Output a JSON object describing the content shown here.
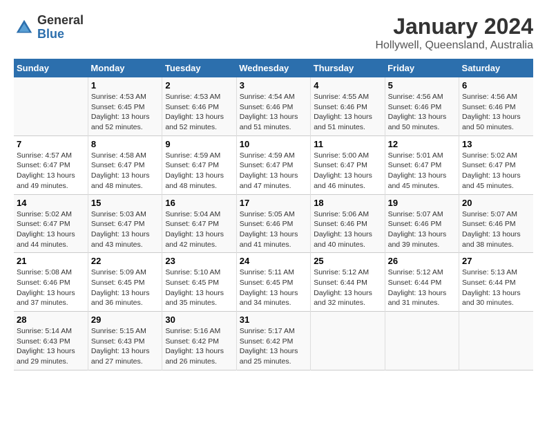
{
  "header": {
    "logo_line1": "General",
    "logo_line2": "Blue",
    "title": "January 2024",
    "subtitle": "Hollywell, Queensland, Australia"
  },
  "days_of_week": [
    "Sunday",
    "Monday",
    "Tuesday",
    "Wednesday",
    "Thursday",
    "Friday",
    "Saturday"
  ],
  "weeks": [
    [
      {
        "day": "",
        "info": ""
      },
      {
        "day": "1",
        "info": "Sunrise: 4:53 AM\nSunset: 6:45 PM\nDaylight: 13 hours\nand 52 minutes."
      },
      {
        "day": "2",
        "info": "Sunrise: 4:53 AM\nSunset: 6:46 PM\nDaylight: 13 hours\nand 52 minutes."
      },
      {
        "day": "3",
        "info": "Sunrise: 4:54 AM\nSunset: 6:46 PM\nDaylight: 13 hours\nand 51 minutes."
      },
      {
        "day": "4",
        "info": "Sunrise: 4:55 AM\nSunset: 6:46 PM\nDaylight: 13 hours\nand 51 minutes."
      },
      {
        "day": "5",
        "info": "Sunrise: 4:56 AM\nSunset: 6:46 PM\nDaylight: 13 hours\nand 50 minutes."
      },
      {
        "day": "6",
        "info": "Sunrise: 4:56 AM\nSunset: 6:46 PM\nDaylight: 13 hours\nand 50 minutes."
      }
    ],
    [
      {
        "day": "7",
        "info": "Sunrise: 4:57 AM\nSunset: 6:47 PM\nDaylight: 13 hours\nand 49 minutes."
      },
      {
        "day": "8",
        "info": "Sunrise: 4:58 AM\nSunset: 6:47 PM\nDaylight: 13 hours\nand 48 minutes."
      },
      {
        "day": "9",
        "info": "Sunrise: 4:59 AM\nSunset: 6:47 PM\nDaylight: 13 hours\nand 48 minutes."
      },
      {
        "day": "10",
        "info": "Sunrise: 4:59 AM\nSunset: 6:47 PM\nDaylight: 13 hours\nand 47 minutes."
      },
      {
        "day": "11",
        "info": "Sunrise: 5:00 AM\nSunset: 6:47 PM\nDaylight: 13 hours\nand 46 minutes."
      },
      {
        "day": "12",
        "info": "Sunrise: 5:01 AM\nSunset: 6:47 PM\nDaylight: 13 hours\nand 45 minutes."
      },
      {
        "day": "13",
        "info": "Sunrise: 5:02 AM\nSunset: 6:47 PM\nDaylight: 13 hours\nand 45 minutes."
      }
    ],
    [
      {
        "day": "14",
        "info": "Sunrise: 5:02 AM\nSunset: 6:47 PM\nDaylight: 13 hours\nand 44 minutes."
      },
      {
        "day": "15",
        "info": "Sunrise: 5:03 AM\nSunset: 6:47 PM\nDaylight: 13 hours\nand 43 minutes."
      },
      {
        "day": "16",
        "info": "Sunrise: 5:04 AM\nSunset: 6:47 PM\nDaylight: 13 hours\nand 42 minutes."
      },
      {
        "day": "17",
        "info": "Sunrise: 5:05 AM\nSunset: 6:46 PM\nDaylight: 13 hours\nand 41 minutes."
      },
      {
        "day": "18",
        "info": "Sunrise: 5:06 AM\nSunset: 6:46 PM\nDaylight: 13 hours\nand 40 minutes."
      },
      {
        "day": "19",
        "info": "Sunrise: 5:07 AM\nSunset: 6:46 PM\nDaylight: 13 hours\nand 39 minutes."
      },
      {
        "day": "20",
        "info": "Sunrise: 5:07 AM\nSunset: 6:46 PM\nDaylight: 13 hours\nand 38 minutes."
      }
    ],
    [
      {
        "day": "21",
        "info": "Sunrise: 5:08 AM\nSunset: 6:46 PM\nDaylight: 13 hours\nand 37 minutes."
      },
      {
        "day": "22",
        "info": "Sunrise: 5:09 AM\nSunset: 6:45 PM\nDaylight: 13 hours\nand 36 minutes."
      },
      {
        "day": "23",
        "info": "Sunrise: 5:10 AM\nSunset: 6:45 PM\nDaylight: 13 hours\nand 35 minutes."
      },
      {
        "day": "24",
        "info": "Sunrise: 5:11 AM\nSunset: 6:45 PM\nDaylight: 13 hours\nand 34 minutes."
      },
      {
        "day": "25",
        "info": "Sunrise: 5:12 AM\nSunset: 6:44 PM\nDaylight: 13 hours\nand 32 minutes."
      },
      {
        "day": "26",
        "info": "Sunrise: 5:12 AM\nSunset: 6:44 PM\nDaylight: 13 hours\nand 31 minutes."
      },
      {
        "day": "27",
        "info": "Sunrise: 5:13 AM\nSunset: 6:44 PM\nDaylight: 13 hours\nand 30 minutes."
      }
    ],
    [
      {
        "day": "28",
        "info": "Sunrise: 5:14 AM\nSunset: 6:43 PM\nDaylight: 13 hours\nand 29 minutes."
      },
      {
        "day": "29",
        "info": "Sunrise: 5:15 AM\nSunset: 6:43 PM\nDaylight: 13 hours\nand 27 minutes."
      },
      {
        "day": "30",
        "info": "Sunrise: 5:16 AM\nSunset: 6:42 PM\nDaylight: 13 hours\nand 26 minutes."
      },
      {
        "day": "31",
        "info": "Sunrise: 5:17 AM\nSunset: 6:42 PM\nDaylight: 13 hours\nand 25 minutes."
      },
      {
        "day": "",
        "info": ""
      },
      {
        "day": "",
        "info": ""
      },
      {
        "day": "",
        "info": ""
      }
    ]
  ]
}
